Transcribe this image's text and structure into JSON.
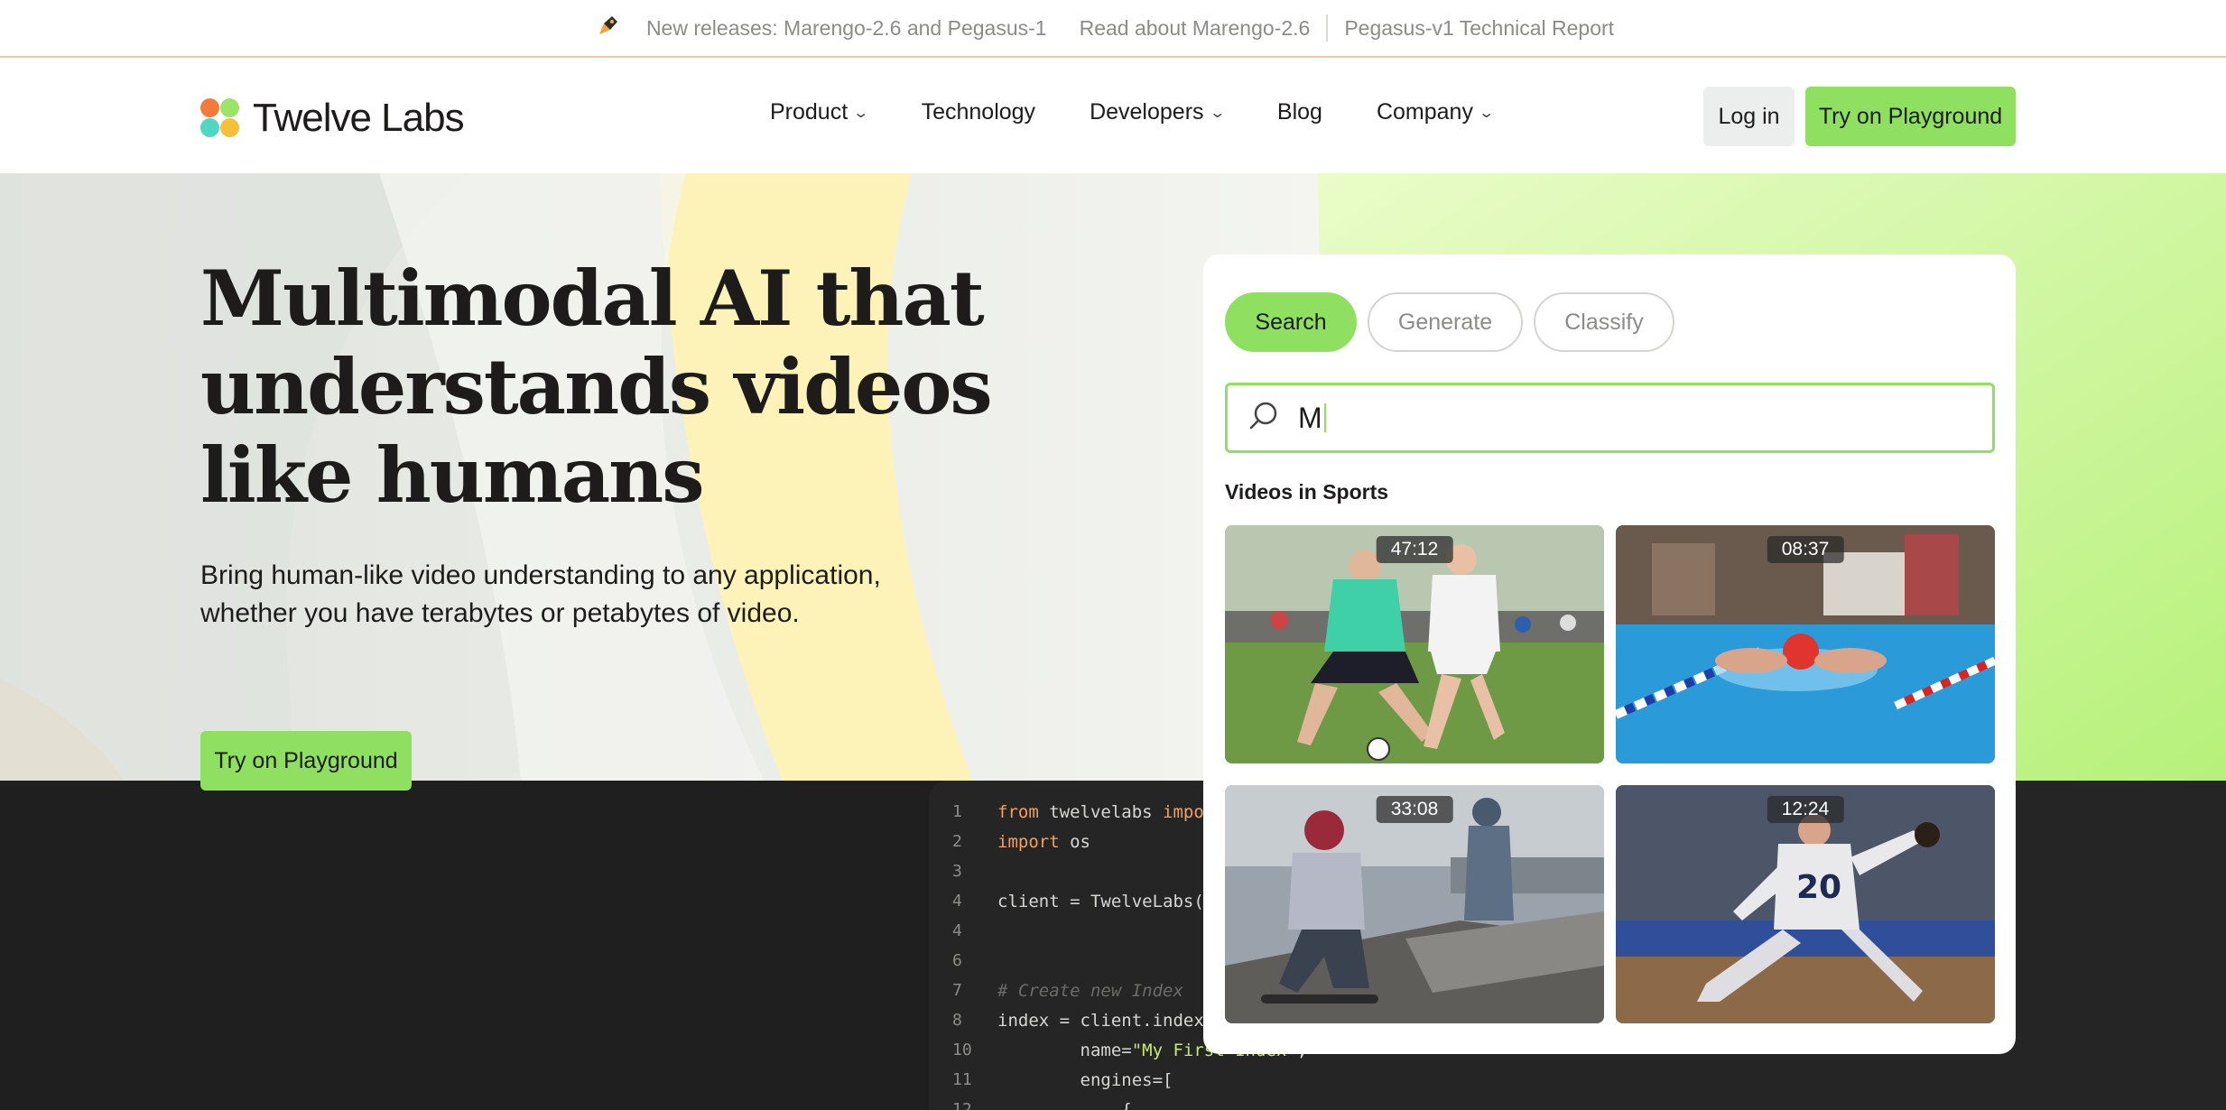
{
  "announcement": {
    "icon": "rocket-icon",
    "items": [
      "New releases: Marengo-2.6 and Pegasus-1",
      "Read about Marengo-2.6",
      "Pegasus-v1 Technical Report"
    ]
  },
  "nav": {
    "logo_text": "Twelve Labs",
    "links": [
      {
        "label": "Product",
        "dropdown": true
      },
      {
        "label": "Technology",
        "dropdown": false
      },
      {
        "label": "Developers",
        "dropdown": true
      },
      {
        "label": "Blog",
        "dropdown": false
      },
      {
        "label": "Company",
        "dropdown": true
      }
    ],
    "login_label": "Log in",
    "cta_label": "Try on Playground"
  },
  "hero": {
    "headline_lines": [
      "Multimodal AI that",
      "understands videos",
      "like humans"
    ],
    "subtitle_lines": [
      "Bring human-like video understanding to any application,",
      "whether you have terabytes or petabytes of video."
    ],
    "cta_label": "Try on Playground"
  },
  "search_card": {
    "tabs": [
      "Search",
      "Generate",
      "Classify"
    ],
    "active_tab": "Search",
    "query": "M",
    "category_label": "Videos in Sports",
    "videos": [
      {
        "duration": "47:12",
        "subject": "soccer"
      },
      {
        "duration": "08:37",
        "subject": "swimming"
      },
      {
        "duration": "33:08",
        "subject": "skateboarding"
      },
      {
        "duration": "12:24",
        "subject": "baseball"
      }
    ]
  },
  "code": {
    "lines": [
      {
        "n": "1",
        "html": "<span class='kw'>from</span> twelvelabs <span class='kw'>import</span>"
      },
      {
        "n": "2",
        "html": "<span class='kw'>import</span> os"
      },
      {
        "n": "3",
        "html": ""
      },
      {
        "n": "4",
        "html": "client = TwelveLabs(<span class='kw'>&lt;</span>"
      },
      {
        "n": "4",
        "html": ""
      },
      {
        "n": "6",
        "html": ""
      },
      {
        "n": "7",
        "html": "<span class='cm'># Create new Index</span>"
      },
      {
        "n": "8",
        "html": "index = client.index."
      },
      {
        "n": "10",
        "html": "        name=<span class='st'>\"My First Index\"</span>,"
      },
      {
        "n": "11",
        "html": "        engines=["
      },
      {
        "n": "12",
        "html": "            {"
      }
    ]
  },
  "colors": {
    "accent_green": "#8fe060",
    "text_dark": "#1d1c1b",
    "muted": "#8b8b87",
    "code_bg": "#252525"
  }
}
